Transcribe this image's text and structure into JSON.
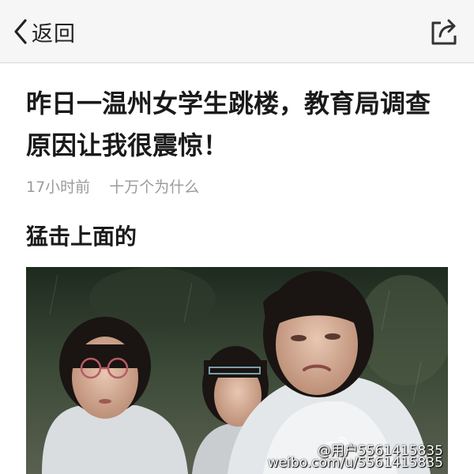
{
  "nav": {
    "back_label": "返回",
    "back_icon": "chevron-left-icon",
    "share_icon": "share-icon"
  },
  "article": {
    "title": "昨日一温州女学生跳楼，教育局调查原因让我很震惊！",
    "time": "17小时前",
    "author": "十万个为什么",
    "subheading": "猛击上面的"
  },
  "photo": {
    "watermark_user": "@用户5561415835",
    "watermark_url": "weibo.com/u/5561415835",
    "watermark_icon": "weibo-logo-icon"
  }
}
